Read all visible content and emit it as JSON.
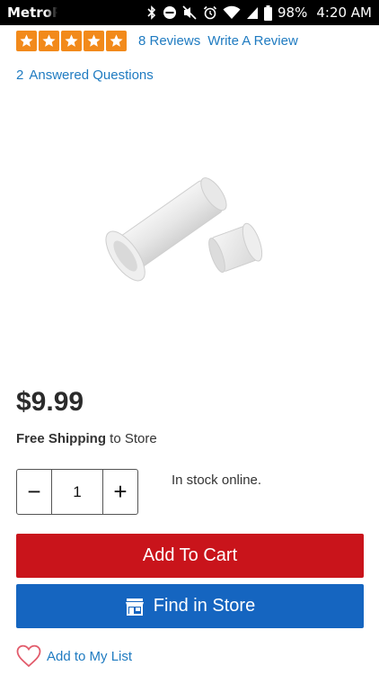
{
  "status_bar": {
    "carrier": "MetroP",
    "battery_percent": "98%",
    "time": "4:20 AM"
  },
  "rating": {
    "stars": 5,
    "star_color": "#f28a1b",
    "reviews_label": "8 Reviews",
    "write_review_label": "Write A Review"
  },
  "questions": {
    "count": "2",
    "label": "Answered Questions"
  },
  "product": {
    "price": "$9.99",
    "shipping_bold": "Free Shipping",
    "shipping_rest": " to Store"
  },
  "quantity": {
    "minus": "−",
    "value": "1",
    "plus": "+"
  },
  "stock_text": "In stock online.",
  "buttons": {
    "add_to_cart": "Add To Cart",
    "find_in_store": "Find in Store",
    "cart_color": "#c9141b",
    "store_color": "#1565c0"
  },
  "wishlist": {
    "label": "Add to My List"
  },
  "colors": {
    "link": "#1f7bc1"
  }
}
